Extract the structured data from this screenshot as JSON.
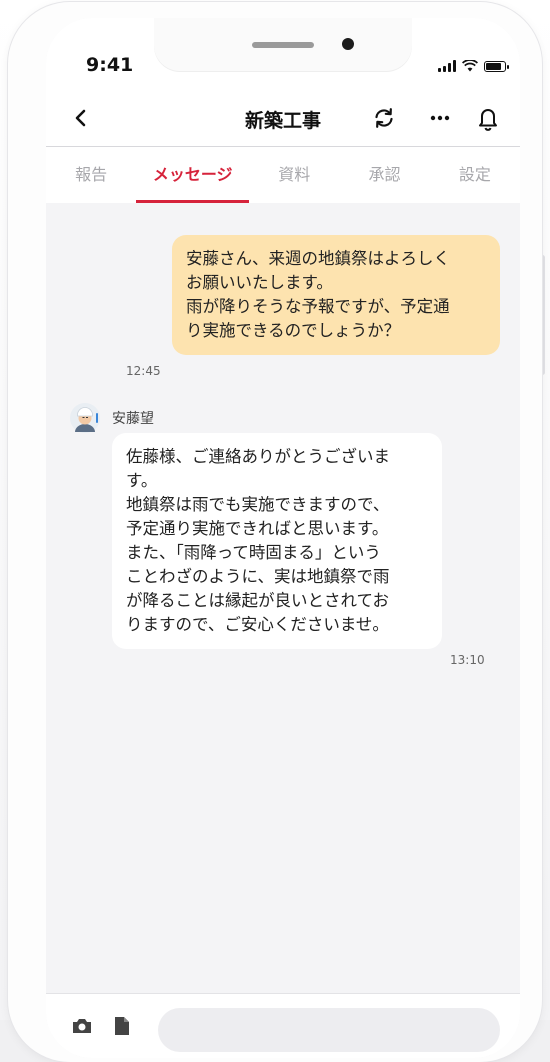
{
  "status": {
    "time": "9:41"
  },
  "header": {
    "title": "新築工事"
  },
  "tabs": [
    {
      "label": "報告"
    },
    {
      "label": "メッセージ"
    },
    {
      "label": "資料"
    },
    {
      "label": "承認"
    },
    {
      "label": "設定"
    }
  ],
  "messages": {
    "outgoing": {
      "text_lines": [
        "安藤さん、来週の地鎮祭はよろしく",
        "お願いいたします。",
        "雨が降りそうな予報ですが、予定通",
        "り実施できるのでしょうか？"
      ],
      "time": "12:45"
    },
    "incoming": {
      "sender": "安藤望",
      "text_lines": [
        "佐藤様、ご連絡ありがとうございま",
        "す。",
        "地鎮祭は雨でも実施できますので、",
        "予定通り実施できればと思います。",
        "また、「雨降って時固まる」という",
        "ことわざのように、実は地鎮祭で雨",
        "が降ることは縁起が良いとされてお",
        "りますので、ご安心くださいませ。"
      ],
      "time": "13:10"
    }
  },
  "colors": {
    "accent": "#d6233b",
    "outgoing_bubble": "#fde3af",
    "incoming_bubble": "#ffffff",
    "chat_background": "#f4f4f6"
  },
  "icons": {
    "back": "chevron-left-icon",
    "sync": "sync-icon",
    "more": "more-horizontal-icon",
    "notifications": "bell-icon",
    "camera": "camera-icon",
    "file": "file-icon"
  }
}
